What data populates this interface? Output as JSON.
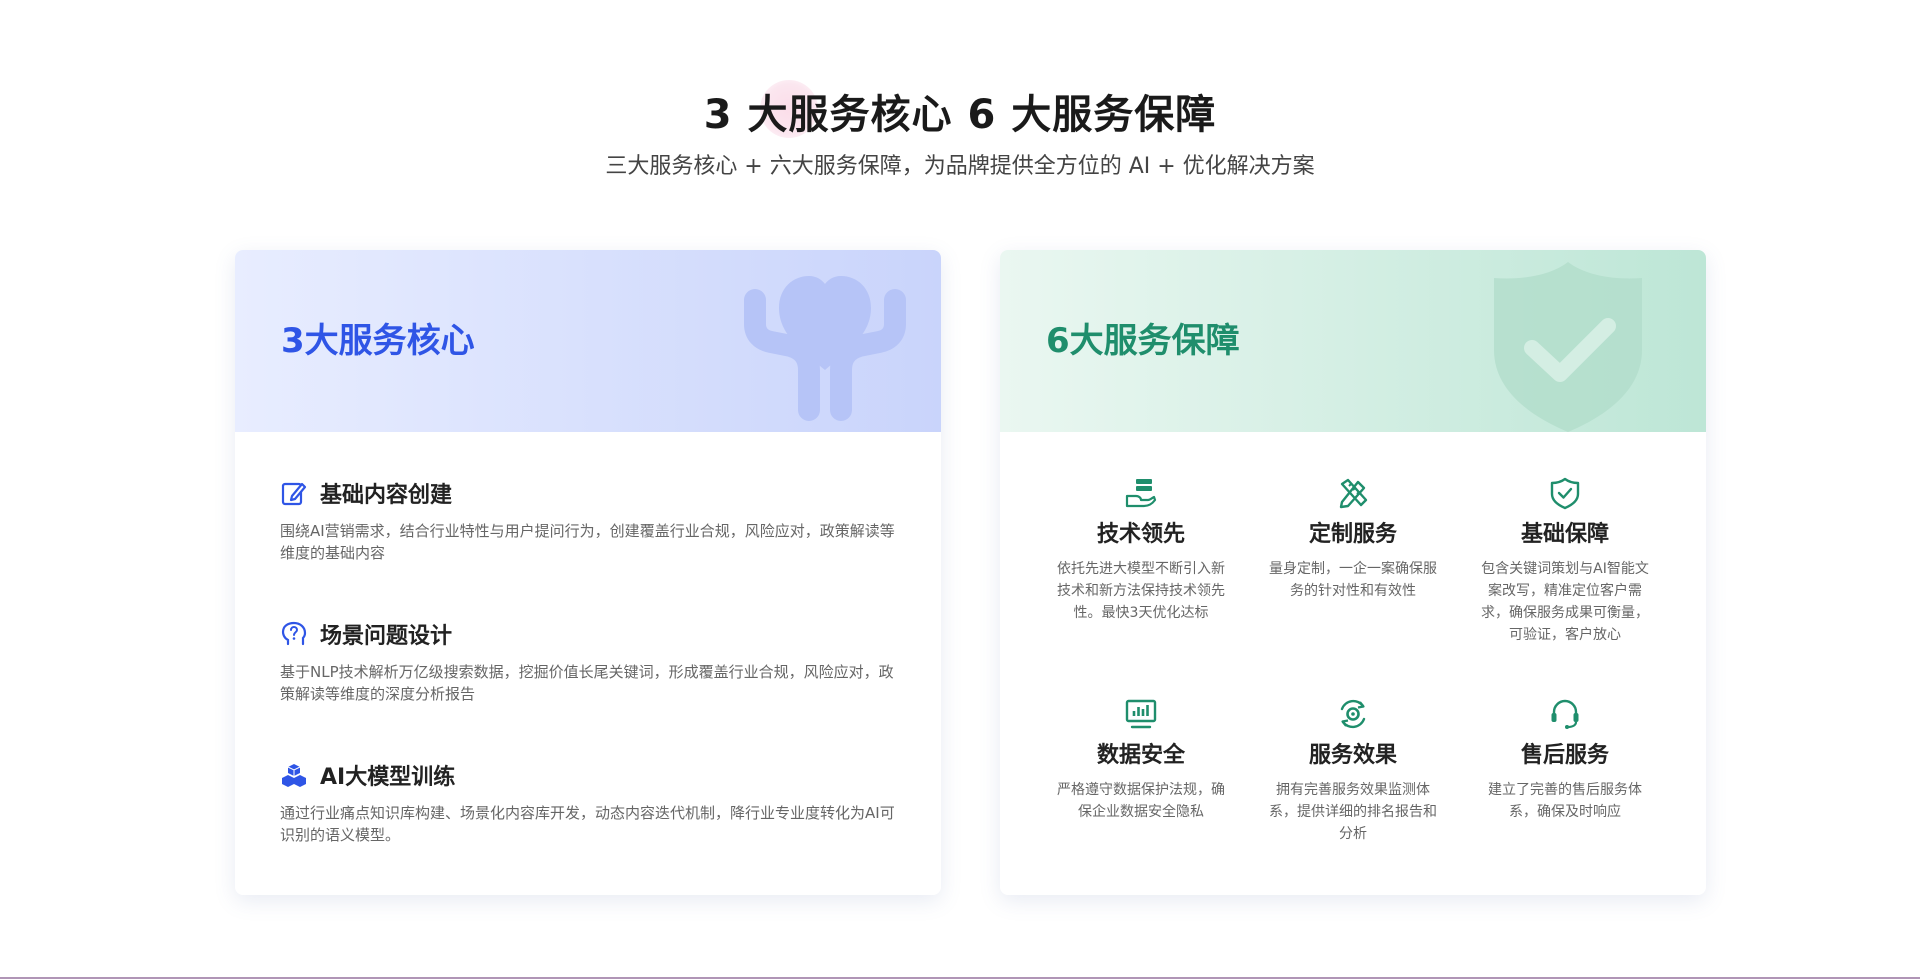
{
  "header": {
    "title": "3 大服务核心 6 大服务保障",
    "subtitle": "三大服务核心 + 六大服务保障，为品牌提供全方位的 AI + 优化解决方案"
  },
  "colors": {
    "core_accent": "#2f55e6",
    "guarantee_accent": "#1f8e6c",
    "core_icon": "#2f55e6",
    "guarantee_icon": "#1f8e6c"
  },
  "core_card": {
    "title": "3大服务核心",
    "header_icon": "heart-hands-icon",
    "items": [
      {
        "icon": "edit-icon",
        "label": "基础内容创建",
        "desc": "围绕AI营销需求，结合行业特性与用户提问行为，创建覆盖行业合规，风险应对，政策解读等维度的基础内容"
      },
      {
        "icon": "question-head-icon",
        "label": "场景问题设计",
        "desc": "基于NLP技术解析万亿级搜索数据，挖掘价值长尾关键词，形成覆盖行业合规，风险应对，政策解读等维度的深度分析报告"
      },
      {
        "icon": "cubes-icon",
        "label": "AI大模型训练",
        "desc": "通过行业痛点知识库构建、场景化内容库开发，动态内容迭代机制，降行业专业度转化为AI可识别的语义模型。"
      }
    ]
  },
  "guarantee_card": {
    "title": "6大服务保障",
    "header_icon": "shield-check-icon",
    "items": [
      {
        "icon": "server-hand-icon",
        "label": "技术领先",
        "desc": "依托先进大模型不断引入新技术和新方法保持技术领先性。最快3天优化达标"
      },
      {
        "icon": "pencil-ruler-icon",
        "label": "定制服务",
        "desc": "量身定制，一企一案确保服务的针对性和有效性"
      },
      {
        "icon": "shield-check-small-icon",
        "label": "基础保障",
        "desc": "包含关键词策划与AI智能文案改写，精准定位客户需求，确保服务成果可衡量，可验证，客户放心"
      },
      {
        "icon": "monitor-chart-icon",
        "label": "数据安全",
        "desc": "严格遵守数据保护法规，确保企业数据安全隐私"
      },
      {
        "icon": "gear-cycle-icon",
        "label": "服务效果",
        "desc": "拥有完善服务效果监测体系，提供详细的排名报告和分析"
      },
      {
        "icon": "headset-icon",
        "label": "售后服务",
        "desc": "建立了完善的售后服务体系，确保及时响应"
      }
    ]
  }
}
